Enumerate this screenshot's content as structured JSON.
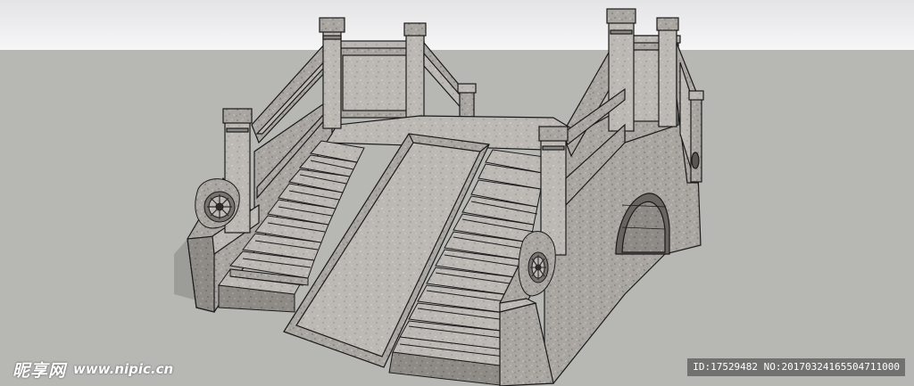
{
  "scene": {
    "subject": "stone-arch-bridge-3d-render",
    "colors": {
      "sky_top": "#e4e4e6",
      "sky_bottom": "#f6f6f7",
      "ground": "#b7b7b4",
      "stone_light": "#b4b1ad",
      "stone_mid": "#9a9793",
      "stone_dark": "#77746f",
      "outline": "#1a1a1a",
      "shadow": "#8f8f8c"
    }
  },
  "watermark": {
    "brand": "昵享网",
    "url": "www.nipic.cn",
    "id_text": "ID:17529482 NO:20170324165504711000"
  }
}
